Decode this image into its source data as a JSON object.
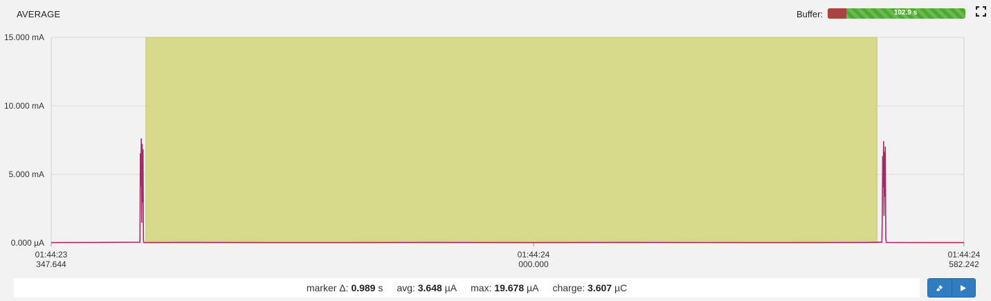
{
  "header": {
    "title": "AVERAGE",
    "buffer_label": "Buffer:",
    "buffer_value": "102.9 s",
    "buffer_used_fraction": 0.135,
    "expand_icon": "expand-icon"
  },
  "colors": {
    "selection": "#d6d98a",
    "trace": "#a32b68",
    "grid": "#d9d9d9",
    "buffer_used": "#a94442",
    "buffer_free": "#4caa2c",
    "button": "#2f7dc0"
  },
  "chart_data": {
    "type": "line",
    "title": "AVERAGE",
    "ylabel": "",
    "xlabel": "",
    "ylim": [
      0,
      15
    ],
    "y_ticks": [
      {
        "value": 0,
        "label": "0.000 µA"
      },
      {
        "value": 5,
        "label": "5.000 mA"
      },
      {
        "value": 10,
        "label": "10.000 mA"
      },
      {
        "value": 15,
        "label": "15.000 mA"
      }
    ],
    "xlim": [
      0,
      1.2346
    ],
    "x_ticks": [
      {
        "value": 0,
        "line1": "01:44:23",
        "line2": "347.644"
      },
      {
        "value": 0.652356,
        "line1": "01:44:24",
        "line2": "000.000"
      },
      {
        "value": 1.234598,
        "line1": "01:44:24",
        "line2": "582.242"
      }
    ],
    "selection": {
      "start": 0.128,
      "end": 1.117
    },
    "series": [
      {
        "x": [
          0,
          0.06,
          0.12,
          0.1202,
          0.1206,
          0.1212,
          0.1218,
          0.1224,
          0.123,
          0.1236,
          0.1242,
          0.1248,
          0.1252,
          0.126,
          0.2,
          0.35,
          0.5,
          0.65,
          0.8,
          0.95,
          1.1,
          1.1235,
          1.124,
          1.1246,
          1.1252,
          1.1258,
          1.1264,
          1.127,
          1.1276,
          1.1282,
          1.1288,
          1.1296,
          1.18,
          1.2346
        ],
        "values": [
          0.02,
          0.03,
          0.05,
          1.9,
          6.5,
          4.2,
          7.6,
          1.5,
          7.2,
          3.0,
          6.8,
          0.2,
          0.03,
          0.02,
          0.03,
          0.02,
          0.03,
          0.02,
          0.03,
          0.02,
          0.03,
          0.05,
          1.4,
          6.3,
          4.1,
          7.4,
          2.0,
          6.6,
          3.4,
          7.0,
          0.3,
          0.03,
          0.02,
          0.02
        ]
      }
    ]
  },
  "stats": {
    "marker_label": "marker Δ:",
    "marker_value": "0.989",
    "marker_unit": "s",
    "avg_label": "avg:",
    "avg_value": "3.648",
    "avg_unit": "µA",
    "max_label": "max:",
    "max_value": "19.678",
    "max_unit": "µA",
    "charge_label": "charge:",
    "charge_value": "3.607",
    "charge_unit": "µC"
  },
  "buttons": {
    "left_icon": "eraser-icon",
    "right_icon": "play-icon"
  }
}
